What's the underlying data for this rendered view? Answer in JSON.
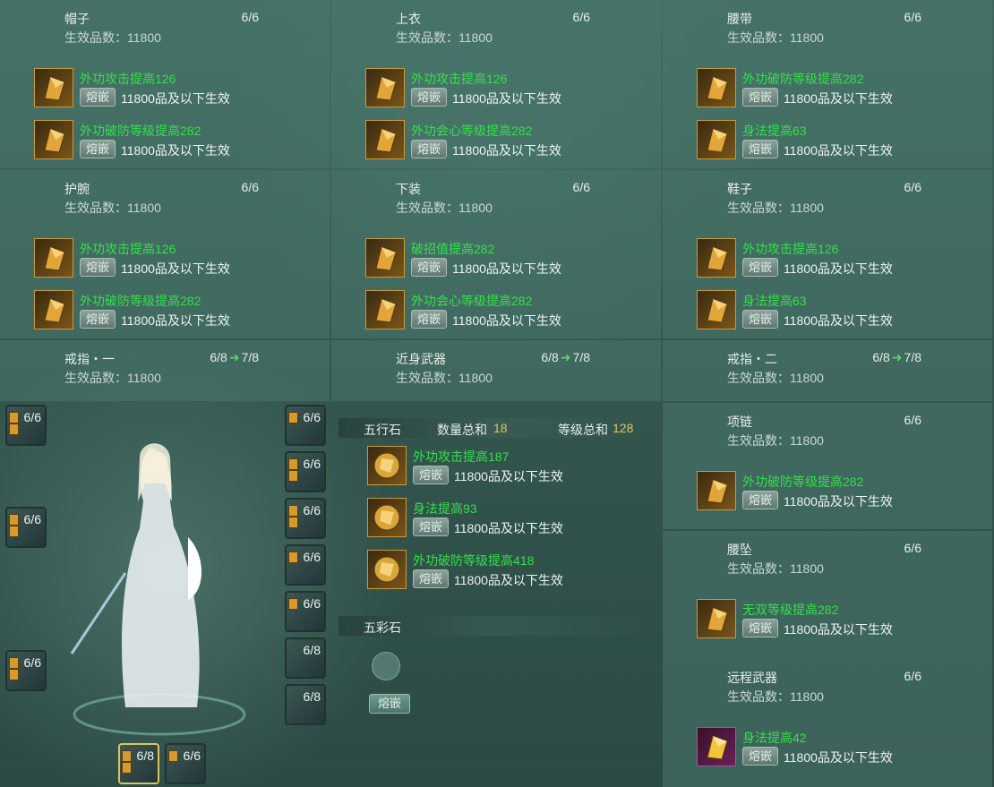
{
  "panels": [
    {
      "name": "帽子",
      "count": "6/6",
      "quality": "生效品数：11800",
      "gems": [
        {
          "name": "外功攻击提高126",
          "btn": "熔嵌",
          "eff": "11800品及以下生效"
        },
        {
          "name": "外功破防等级提高282",
          "btn": "熔嵌",
          "eff": "11800品及以下生效"
        }
      ]
    },
    {
      "name": "上衣",
      "count": "6/6",
      "quality": "生效品数：11800",
      "gems": [
        {
          "name": "外功攻击提高126",
          "btn": "熔嵌",
          "eff": "11800品及以下生效"
        },
        {
          "name": "外功会心等级提高282",
          "btn": "熔嵌",
          "eff": "11800品及以下生效"
        }
      ]
    },
    {
      "name": "腰带",
      "count": "6/6",
      "quality": "生效品数：11800",
      "gems": [
        {
          "name": "外功破防等级提高282",
          "btn": "熔嵌",
          "eff": "11800品及以下生效"
        },
        {
          "name": "身法提高63",
          "btn": "熔嵌",
          "eff": "11800品及以下生效"
        }
      ]
    },
    {
      "name": "护腕",
      "count": "6/6",
      "quality": "生效品数：11800",
      "gems": [
        {
          "name": "外功攻击提高126",
          "btn": "熔嵌",
          "eff": "11800品及以下生效"
        },
        {
          "name": "外功破防等级提高282",
          "btn": "熔嵌",
          "eff": "11800品及以下生效"
        }
      ]
    },
    {
      "name": "下装",
      "count": "6/6",
      "quality": "生效品数：11800",
      "gems": [
        {
          "name": "破招值提高282",
          "btn": "熔嵌",
          "eff": "11800品及以下生效"
        },
        {
          "name": "外功会心等级提高282",
          "btn": "熔嵌",
          "eff": "11800品及以下生效"
        }
      ]
    },
    {
      "name": "鞋子",
      "count": "6/6",
      "quality": "生效品数：11800",
      "gems": [
        {
          "name": "外功攻击提高126",
          "btn": "熔嵌",
          "eff": "11800品及以下生效"
        },
        {
          "name": "身法提高63",
          "btn": "熔嵌",
          "eff": "11800品及以下生效"
        }
      ]
    },
    {
      "name": "戒指・一",
      "count": "6/8",
      "count_up": "7/8",
      "quality": "生效品数：11800",
      "gems": []
    },
    {
      "name": "近身武器",
      "count": "6/8",
      "count_up": "7/8",
      "quality": "生效品数：11800",
      "gems": []
    },
    {
      "name": "戒指・二",
      "count": "6/8",
      "count_up": "7/8",
      "quality": "生效品数：11800",
      "gems": []
    },
    {
      "name": "项链",
      "count": "6/6",
      "quality": "生效品数：11800",
      "gems": [
        {
          "name": "外功破防等级提高282",
          "btn": "熔嵌",
          "eff": "11800品及以下生效"
        }
      ]
    },
    {
      "name": "腰坠",
      "count": "6/6",
      "quality": "生效品数：11800",
      "gems": [
        {
          "name": "无双等级提高282",
          "btn": "熔嵌",
          "eff": "11800品及以下生效"
        }
      ]
    },
    {
      "name": "远程武器",
      "count": "6/6",
      "quality": "生效品数：11800",
      "gems": [
        {
          "name": "身法提高42",
          "btn": "熔嵌",
          "eff": "11800品及以下生效"
        }
      ]
    }
  ],
  "wuxing": {
    "title": "五行石",
    "sum_qty_label": "数量总和",
    "sum_qty": "18",
    "sum_lvl_label": "等级总和",
    "sum_lvl": "128",
    "gems": [
      {
        "name": "外功攻击提高187",
        "btn": "熔嵌",
        "eff": "11800品及以下生效"
      },
      {
        "name": "身法提高93",
        "btn": "熔嵌",
        "eff": "11800品及以下生效"
      },
      {
        "name": "外功破防等级提高418",
        "btn": "熔嵌",
        "eff": "11800品及以下生效"
      }
    ]
  },
  "wucai": {
    "title": "五彩石",
    "btn": "熔嵌"
  },
  "slots": {
    "left": [
      "6/6",
      "6/6",
      "6/6"
    ],
    "right": [
      "6/6",
      "6/6",
      "6/6",
      "6/6",
      "6/6",
      "6/8",
      "6/8"
    ],
    "bottom": [
      "6/8",
      "6/6"
    ]
  },
  "colors": {
    "gem_name": "#33e04a",
    "gold": "#e8c35a",
    "accent_arrow": "#5fd06a"
  }
}
